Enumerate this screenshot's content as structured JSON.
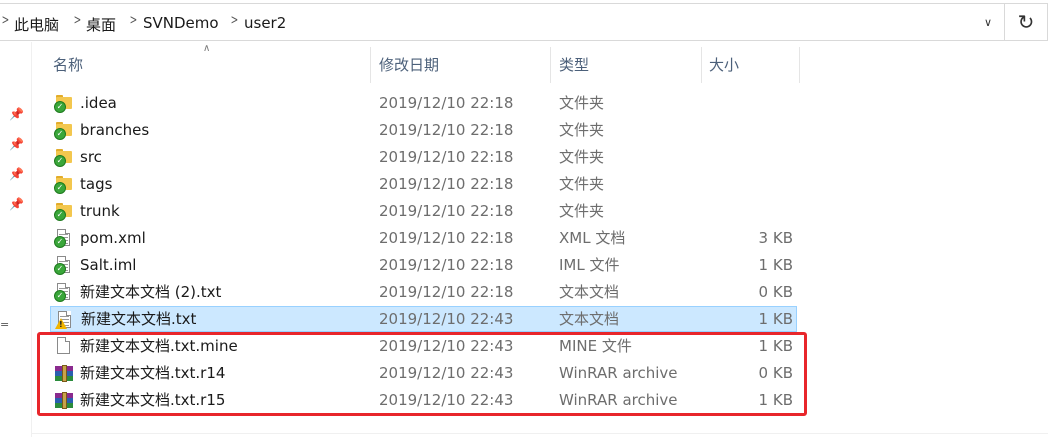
{
  "breadcrumb": [
    "此电脑",
    "桌面",
    "SVNDemo",
    "user2"
  ],
  "columns": {
    "name": "名称",
    "date": "修改日期",
    "type": "类型",
    "size": "大小"
  },
  "files": [
    {
      "name": ".idea",
      "date": "2019/12/10 22:18",
      "type": "文件夹",
      "size": "",
      "icon": "folder",
      "overlay": "svn-ok"
    },
    {
      "name": "branches",
      "date": "2019/12/10 22:18",
      "type": "文件夹",
      "size": "",
      "icon": "folder",
      "overlay": "svn-ok"
    },
    {
      "name": "src",
      "date": "2019/12/10 22:18",
      "type": "文件夹",
      "size": "",
      "icon": "folder",
      "overlay": "svn-ok"
    },
    {
      "name": "tags",
      "date": "2019/12/10 22:18",
      "type": "文件夹",
      "size": "",
      "icon": "folder",
      "overlay": "svn-ok"
    },
    {
      "name": "trunk",
      "date": "2019/12/10 22:18",
      "type": "文件夹",
      "size": "",
      "icon": "folder",
      "overlay": "svn-ok"
    },
    {
      "name": "pom.xml",
      "date": "2019/12/10 22:18",
      "type": "XML 文档",
      "size": "3 KB",
      "icon": "document",
      "overlay": "svn-ok"
    },
    {
      "name": "Salt.iml",
      "date": "2019/12/10 22:18",
      "type": "IML 文件",
      "size": "1 KB",
      "icon": "document",
      "overlay": "svn-ok"
    },
    {
      "name": "新建文本文档 (2).txt",
      "date": "2019/12/10 22:18",
      "type": "文本文档",
      "size": "0 KB",
      "icon": "document",
      "overlay": "svn-ok"
    },
    {
      "name": "新建文本文档.txt",
      "date": "2019/12/10 22:43",
      "type": "文本文档",
      "size": "1 KB",
      "icon": "document",
      "overlay": "svn-conflict",
      "selected": true
    },
    {
      "name": "新建文本文档.txt.mine",
      "date": "2019/12/10 22:43",
      "type": "MINE 文件",
      "size": "1 KB",
      "icon": "document",
      "overlay": ""
    },
    {
      "name": "新建文本文档.txt.r14",
      "date": "2019/12/10 22:43",
      "type": "WinRAR archive",
      "size": "0 KB",
      "icon": "winrar-archive",
      "overlay": ""
    },
    {
      "name": "新建文本文档.txt.r15",
      "date": "2019/12/10 22:43",
      "type": "WinRAR archive",
      "size": "1 KB",
      "icon": "winrar-archive",
      "overlay": ""
    }
  ],
  "colors": {
    "selection": "#cce8ff",
    "highlight_box": "#e8262b",
    "folder": "#f3c74e",
    "svn_ok": "#3aa63a"
  }
}
